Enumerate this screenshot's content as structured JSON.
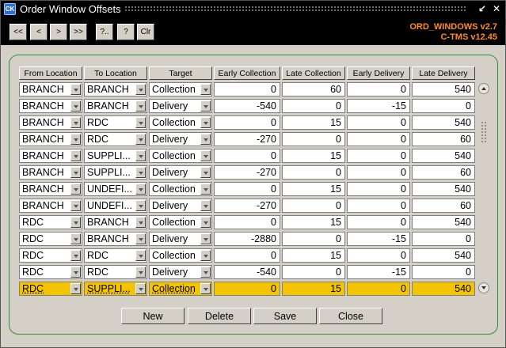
{
  "window": {
    "title": "Order Window Offsets",
    "icon": "app-icon-ck"
  },
  "toolbar": {
    "first": "<<",
    "prev": "<",
    "next": ">",
    "last": ">>",
    "query": "?..",
    "help": "?",
    "clear": "Clr"
  },
  "version": {
    "line1": "ORD_WINDOWS v2.7",
    "line2": "C-TMS v12.45"
  },
  "columns": [
    "From Location",
    "To Location",
    "Target",
    "Early Collection",
    "Late Collection",
    "Early Delivery",
    "Late Delivery"
  ],
  "rows": [
    {
      "from": "BRANCH",
      "to": "BRANCH",
      "target": "Collection",
      "ec": "0",
      "lc": "60",
      "ed": "0",
      "ld": "540"
    },
    {
      "from": "BRANCH",
      "to": "BRANCH",
      "target": "Delivery",
      "ec": "-540",
      "lc": "0",
      "ed": "-15",
      "ld": "0"
    },
    {
      "from": "BRANCH",
      "to": "RDC",
      "target": "Collection",
      "ec": "0",
      "lc": "15",
      "ed": "0",
      "ld": "540"
    },
    {
      "from": "BRANCH",
      "to": "RDC",
      "target": "Delivery",
      "ec": "-270",
      "lc": "0",
      "ed": "0",
      "ld": "60"
    },
    {
      "from": "BRANCH",
      "to": "SUPPLI...",
      "target": "Collection",
      "ec": "0",
      "lc": "15",
      "ed": "0",
      "ld": "540"
    },
    {
      "from": "BRANCH",
      "to": "SUPPLI...",
      "target": "Delivery",
      "ec": "-270",
      "lc": "0",
      "ed": "0",
      "ld": "60"
    },
    {
      "from": "BRANCH",
      "to": "UNDEFI...",
      "target": "Collection",
      "ec": "0",
      "lc": "15",
      "ed": "0",
      "ld": "540"
    },
    {
      "from": "BRANCH",
      "to": "UNDEFI...",
      "target": "Delivery",
      "ec": "-270",
      "lc": "0",
      "ed": "0",
      "ld": "60"
    },
    {
      "from": "RDC",
      "to": "BRANCH",
      "target": "Collection",
      "ec": "0",
      "lc": "15",
      "ed": "0",
      "ld": "540"
    },
    {
      "from": "RDC",
      "to": "BRANCH",
      "target": "Delivery",
      "ec": "-2880",
      "lc": "0",
      "ed": "-15",
      "ld": "0"
    },
    {
      "from": "RDC",
      "to": "RDC",
      "target": "Collection",
      "ec": "0",
      "lc": "15",
      "ed": "0",
      "ld": "540"
    },
    {
      "from": "RDC",
      "to": "RDC",
      "target": "Delivery",
      "ec": "-540",
      "lc": "0",
      "ed": "-15",
      "ld": "0"
    },
    {
      "from": "RDC",
      "to": "SUPPLI...",
      "target": "Collection",
      "ec": "0",
      "lc": "15",
      "ed": "0",
      "ld": "540",
      "selected": true
    }
  ],
  "buttons": {
    "new": "New",
    "delete": "Delete",
    "save": "Save",
    "close": "Close"
  },
  "colors": {
    "selected_row": "#f5c400",
    "version_text": "#ff8c2a",
    "panel_border": "#3a8a3a"
  }
}
